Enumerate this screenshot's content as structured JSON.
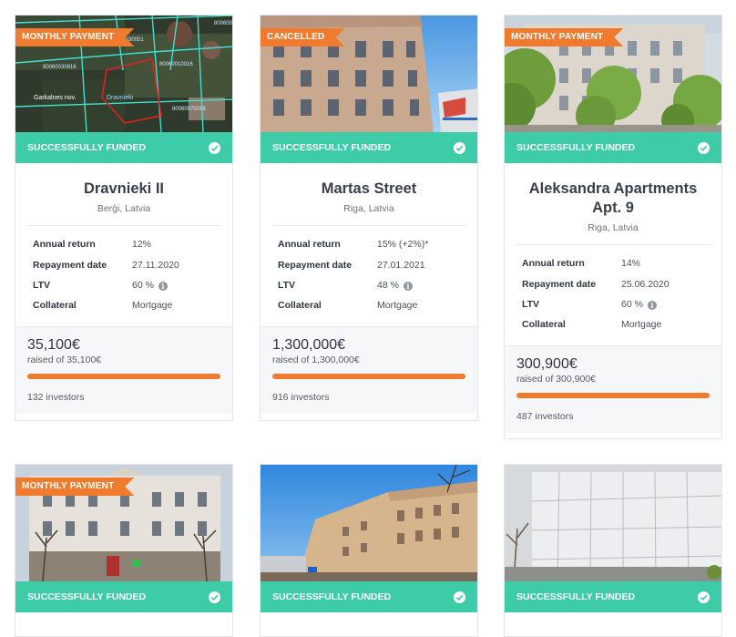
{
  "cards": [
    {
      "ribbon": "MONTHLY PAYMENT",
      "status": "SUCCESSFULLY FUNDED",
      "title": "Dravnieki II",
      "location": "Berģi, Latvia",
      "map_labels": [
        "Garkalnes nov.",
        "Dravnieki"
      ],
      "terms": [
        {
          "label": "Annual return",
          "value": "12%"
        },
        {
          "label": "Repayment date",
          "value": "27.11.2020"
        },
        {
          "label": "LTV",
          "value": "60 %"
        },
        {
          "label": "Collateral",
          "value": "Mortgage"
        }
      ],
      "amount": "35,100€",
      "raised": "raised of 35,100€",
      "funded_fraction": 1.0,
      "investors": "132 investors"
    },
    {
      "ribbon": "CANCELLED",
      "status": "SUCCESSFULLY FUNDED",
      "title": "Martas Street",
      "location": "Riga, Latvia",
      "terms": [
        {
          "label": "Annual return",
          "value": "15% (+2%)*"
        },
        {
          "label": "Repayment date",
          "value": "27.01.2021"
        },
        {
          "label": "LTV",
          "value": "48 %"
        },
        {
          "label": "Collateral",
          "value": "Mortgage"
        }
      ],
      "amount": "1,300,000€",
      "raised": "raised of 1,300,000€",
      "funded_fraction": 1.0,
      "investors": "916 investors"
    },
    {
      "ribbon": "MONTHLY PAYMENT",
      "status": "SUCCESSFULLY FUNDED",
      "title": "Aleksandra Apartments Apt. 9",
      "location": "Riga, Latvia",
      "terms": [
        {
          "label": "Annual return",
          "value": "14%"
        },
        {
          "label": "Repayment date",
          "value": "25.06.2020"
        },
        {
          "label": "LTV",
          "value": "60 %"
        },
        {
          "label": "Collateral",
          "value": "Mortgage"
        }
      ],
      "amount": "300,900€",
      "raised": "raised of 300,900€",
      "funded_fraction": 1.0,
      "investors": "487 investors"
    },
    {
      "ribbon": "MONTHLY PAYMENT",
      "status": "SUCCESSFULLY FUNDED"
    },
    {
      "ribbon": "",
      "status": "SUCCESSFULLY FUNDED"
    },
    {
      "ribbon": "",
      "status": "SUCCESSFULLY FUNDED"
    }
  ],
  "icons": {
    "status": "check-circle-icon",
    "ltv": "info-icon"
  },
  "colors": {
    "accent_orange": "#f07a2d",
    "funded_green": "#3ecba8"
  }
}
